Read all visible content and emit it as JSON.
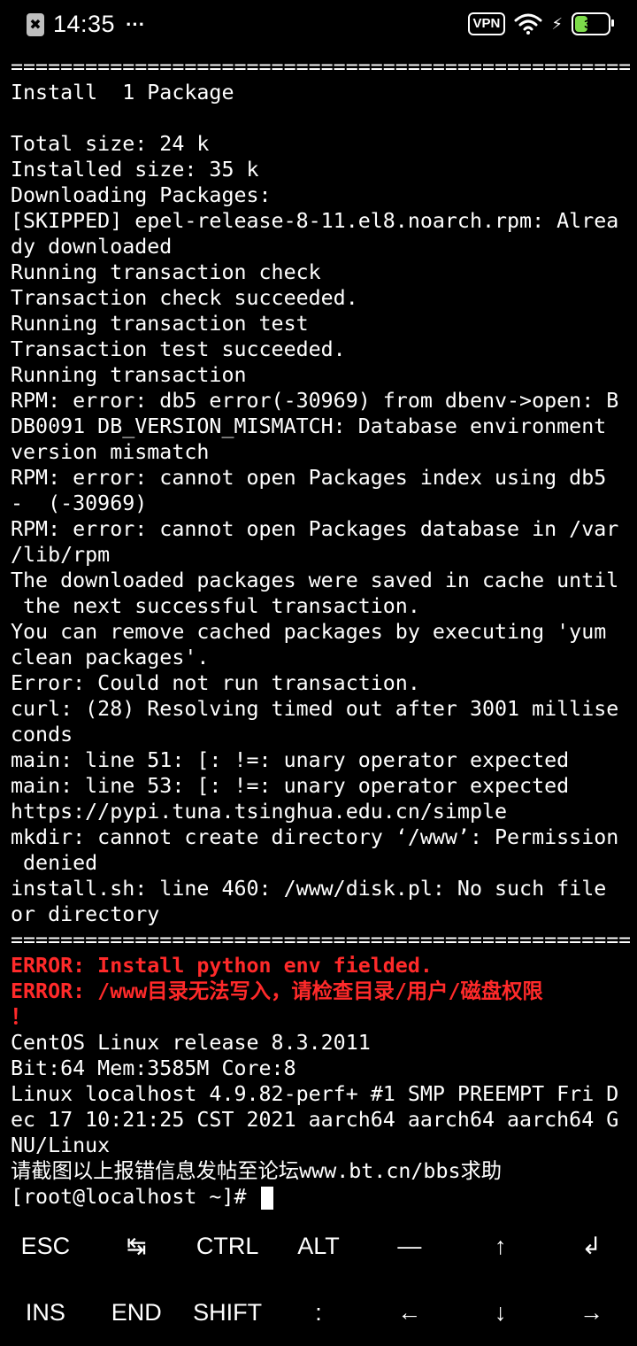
{
  "status_bar": {
    "sim_glyph": "✖",
    "time": "14:35",
    "more": "···",
    "vpn": "VPN",
    "battery_level": "39",
    "battery_fraction": 0.39,
    "battery_color": "#7ddc4a"
  },
  "terminal": {
    "lines": [
      {
        "text": "==================================================",
        "type": "normal"
      },
      {
        "text": "Install  1 Package",
        "type": "normal"
      },
      {
        "text": "",
        "type": "normal"
      },
      {
        "text": "Total size: 24 k",
        "type": "normal"
      },
      {
        "text": "Installed size: 35 k",
        "type": "normal"
      },
      {
        "text": "Downloading Packages:",
        "type": "normal"
      },
      {
        "text": "[SKIPPED] epel-release-8-11.el8.noarch.rpm: Alrea",
        "type": "normal"
      },
      {
        "text": "dy downloaded",
        "type": "normal"
      },
      {
        "text": "Running transaction check",
        "type": "normal"
      },
      {
        "text": "Transaction check succeeded.",
        "type": "normal"
      },
      {
        "text": "Running transaction test",
        "type": "normal"
      },
      {
        "text": "Transaction test succeeded.",
        "type": "normal"
      },
      {
        "text": "Running transaction",
        "type": "normal"
      },
      {
        "text": "RPM: error: db5 error(-30969) from dbenv->open: B",
        "type": "normal"
      },
      {
        "text": "DB0091 DB_VERSION_MISMATCH: Database environment",
        "type": "normal"
      },
      {
        "text": "version mismatch",
        "type": "normal"
      },
      {
        "text": "RPM: error: cannot open Packages index using db5",
        "type": "normal"
      },
      {
        "text": "-  (-30969)",
        "type": "normal"
      },
      {
        "text": "RPM: error: cannot open Packages database in /var",
        "type": "normal"
      },
      {
        "text": "/lib/rpm",
        "type": "normal"
      },
      {
        "text": "The downloaded packages were saved in cache until",
        "type": "normal"
      },
      {
        "text": " the next successful transaction.",
        "type": "normal"
      },
      {
        "text": "You can remove cached packages by executing 'yum",
        "type": "normal"
      },
      {
        "text": "clean packages'.",
        "type": "normal"
      },
      {
        "text": "Error: Could not run transaction.",
        "type": "normal"
      },
      {
        "text": "curl: (28) Resolving timed out after 3001 millise",
        "type": "normal"
      },
      {
        "text": "conds",
        "type": "normal"
      },
      {
        "text": "main: line 51: [: !=: unary operator expected",
        "type": "normal"
      },
      {
        "text": "main: line 53: [: !=: unary operator expected",
        "type": "normal"
      },
      {
        "text": "https://pypi.tuna.tsinghua.edu.cn/simple",
        "type": "normal"
      },
      {
        "text": "mkdir: cannot create directory ‘/www’: Permission",
        "type": "normal"
      },
      {
        "text": " denied",
        "type": "normal"
      },
      {
        "text": "install.sh: line 460: /www/disk.pl: No such file",
        "type": "normal"
      },
      {
        "text": "or directory",
        "type": "normal"
      },
      {
        "text": "==================================================",
        "type": "normal"
      },
      {
        "text": "ERROR: Install python env fielded.",
        "type": "err"
      },
      {
        "text": "ERROR: /www目录无法写入，请检查目录/用户/磁盘权限",
        "type": "err"
      },
      {
        "text": "！",
        "type": "err"
      },
      {
        "text": "CentOS Linux release 8.3.2011",
        "type": "normal"
      },
      {
        "text": "Bit:64 Mem:3585M Core:8",
        "type": "normal"
      },
      {
        "text": "Linux localhost 4.9.82-perf+ #1 SMP PREEMPT Fri D",
        "type": "normal"
      },
      {
        "text": "ec 17 10:21:25 CST 2021 aarch64 aarch64 aarch64 G",
        "type": "normal"
      },
      {
        "text": "NU/Linux",
        "type": "normal"
      },
      {
        "text": "请截图以上报错信息发帖至论坛www.bt.cn/bbs求助",
        "type": "normal"
      }
    ],
    "prompt": "[root@localhost ~]# ",
    "error_color": "#ff2a2a"
  },
  "extra_keys": {
    "row1": [
      {
        "label": "ESC",
        "icon": "escape-key"
      },
      {
        "label": "↹",
        "icon": "tab-icon"
      },
      {
        "label": "CTRL",
        "icon": "ctrl-key"
      },
      {
        "label": "ALT",
        "icon": "alt-key"
      },
      {
        "label": "—",
        "icon": "dash-key"
      },
      {
        "label": "↑",
        "icon": "arrow-up-icon"
      },
      {
        "label": "↲",
        "icon": "enter-icon"
      }
    ],
    "row2": [
      {
        "label": "INS",
        "icon": "insert-key"
      },
      {
        "label": "END",
        "icon": "end-key"
      },
      {
        "label": "SHIFT",
        "icon": "shift-key"
      },
      {
        "label": ":",
        "icon": "colon-key"
      },
      {
        "label": "←",
        "icon": "arrow-left-icon"
      },
      {
        "label": "↓",
        "icon": "arrow-down-icon"
      },
      {
        "label": "→",
        "icon": "arrow-right-icon"
      }
    ]
  }
}
